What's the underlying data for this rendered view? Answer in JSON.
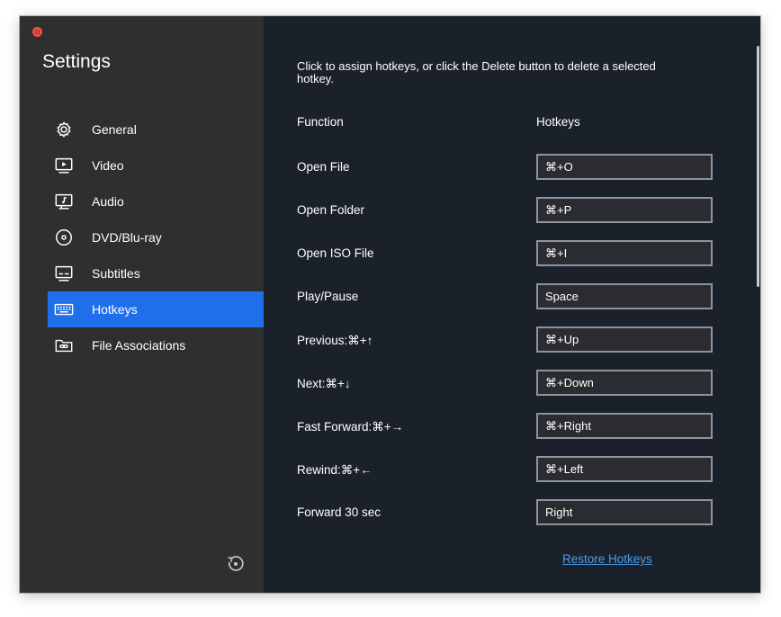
{
  "window": {
    "title": "Settings"
  },
  "sidebar": {
    "items": [
      {
        "label": "General",
        "icon": "gear-icon",
        "active": false
      },
      {
        "label": "Video",
        "icon": "video-icon",
        "active": false
      },
      {
        "label": "Audio",
        "icon": "audio-icon",
        "active": false
      },
      {
        "label": "DVD/Blu-ray",
        "icon": "disc-icon",
        "active": false
      },
      {
        "label": "Subtitles",
        "icon": "subtitles-icon",
        "active": false
      },
      {
        "label": "Hotkeys",
        "icon": "keyboard-icon",
        "active": true
      },
      {
        "label": "File Associations",
        "icon": "folder-link-icon",
        "active": false
      }
    ],
    "reset_icon": "reset-icon"
  },
  "main": {
    "instructions": "Click to assign hotkeys, or click the Delete button to delete a selected hotkey.",
    "columns": {
      "function": "Function",
      "hotkeys": "Hotkeys"
    },
    "rows": [
      {
        "function": "Open File",
        "hotkey": "⌘+O"
      },
      {
        "function": "Open Folder",
        "hotkey": "⌘+P"
      },
      {
        "function": "Open ISO File",
        "hotkey": "⌘+I"
      },
      {
        "function": "Play/Pause",
        "hotkey": "Space"
      },
      {
        "function": "Previous:⌘+↑",
        "hotkey": "⌘+Up"
      },
      {
        "function": "Next:⌘+↓",
        "hotkey": "⌘+Down"
      },
      {
        "function": "Fast Forward:⌘+→",
        "hotkey": "⌘+Right"
      },
      {
        "function": "Rewind:⌘+←",
        "hotkey": "⌘+Left"
      },
      {
        "function": "Forward 30 sec",
        "hotkey": "Right"
      }
    ],
    "restore_label": "Restore Hotkeys"
  },
  "colors": {
    "sidebar_bg": "#2f2f2f",
    "content_bg": "#1b212b",
    "accent": "#1f6feb",
    "link": "#4b9dea",
    "field_bg": "#2a2c31",
    "field_border": "#8f949b"
  }
}
